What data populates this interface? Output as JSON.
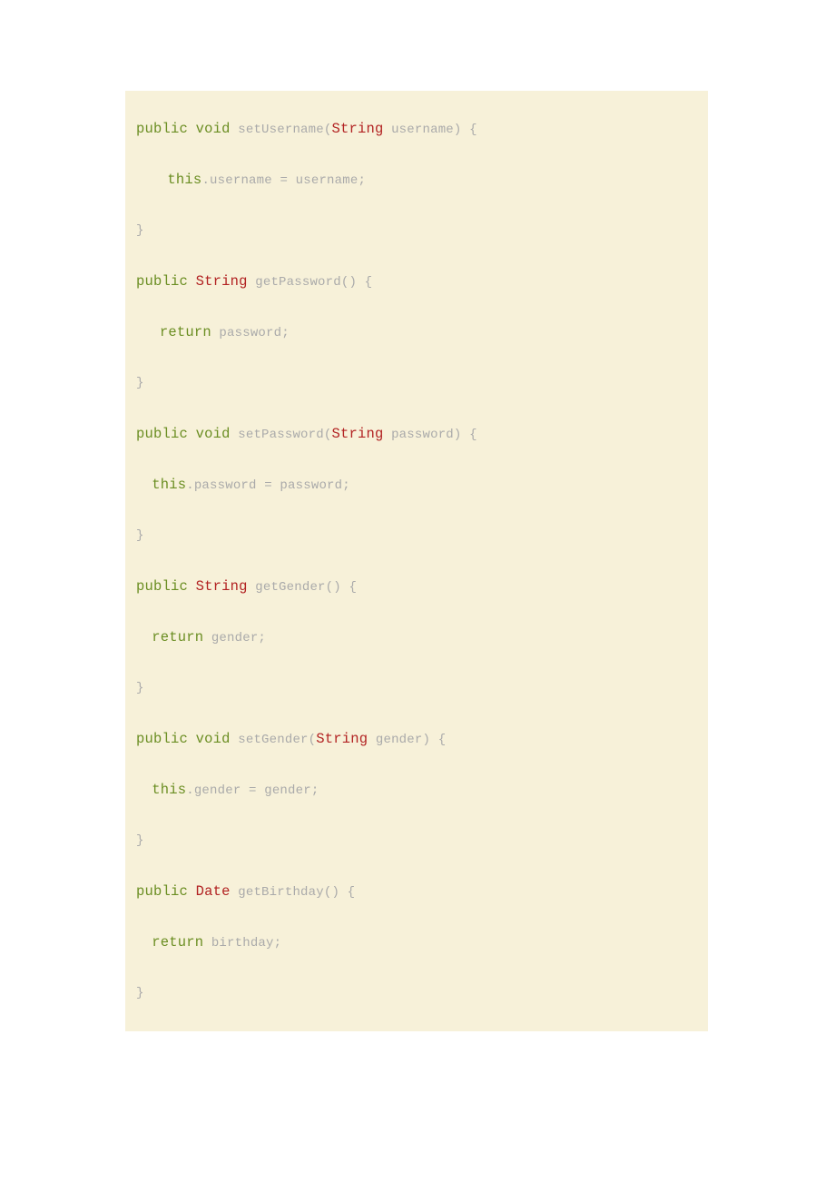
{
  "code": {
    "lines": [
      {
        "indent": 0,
        "segments": [
          {
            "t": "public",
            "c": "kw-public"
          },
          {
            "t": " "
          },
          {
            "t": "void",
            "c": "kw-void"
          },
          {
            "t": " "
          },
          {
            "t": "setUsername("
          },
          {
            "t": "String",
            "c": "kw-type"
          },
          {
            "t": " username) {"
          }
        ]
      },
      {
        "indent": 0,
        "segments": [
          {
            "t": ""
          }
        ]
      },
      {
        "indent": 3,
        "segments": [
          {
            "t": " "
          },
          {
            "t": "this",
            "c": "kw-this"
          },
          {
            "t": ".username = username;"
          }
        ]
      },
      {
        "indent": 0,
        "segments": [
          {
            "t": ""
          }
        ]
      },
      {
        "indent": 0,
        "segments": [
          {
            "t": "}"
          }
        ]
      },
      {
        "indent": 0,
        "segments": [
          {
            "t": ""
          }
        ]
      },
      {
        "indent": 0,
        "segments": [
          {
            "t": "public",
            "c": "kw-public"
          },
          {
            "t": " "
          },
          {
            "t": "String",
            "c": "kw-type"
          },
          {
            "t": " getPassword() {"
          }
        ]
      },
      {
        "indent": 0,
        "segments": [
          {
            "t": ""
          }
        ]
      },
      {
        "indent": 3,
        "segments": [
          {
            "t": "return",
            "c": "kw-return"
          },
          {
            "t": " password;"
          }
        ]
      },
      {
        "indent": 0,
        "segments": [
          {
            "t": ""
          }
        ]
      },
      {
        "indent": 0,
        "segments": [
          {
            "t": "}"
          }
        ]
      },
      {
        "indent": 0,
        "segments": [
          {
            "t": ""
          }
        ]
      },
      {
        "indent": 0,
        "segments": [
          {
            "t": "public",
            "c": "kw-public"
          },
          {
            "t": " "
          },
          {
            "t": "void",
            "c": "kw-void"
          },
          {
            "t": " "
          },
          {
            "t": "setPassword("
          },
          {
            "t": "String",
            "c": "kw-type"
          },
          {
            "t": " password) {"
          }
        ]
      },
      {
        "indent": 0,
        "segments": [
          {
            "t": ""
          }
        ]
      },
      {
        "indent": 2,
        "segments": [
          {
            "t": "this",
            "c": "kw-this"
          },
          {
            "t": ".password = password;"
          }
        ]
      },
      {
        "indent": 0,
        "segments": [
          {
            "t": ""
          }
        ]
      },
      {
        "indent": 0,
        "segments": [
          {
            "t": "}"
          }
        ]
      },
      {
        "indent": 0,
        "segments": [
          {
            "t": ""
          }
        ]
      },
      {
        "indent": 0,
        "segments": [
          {
            "t": "public",
            "c": "kw-public"
          },
          {
            "t": " "
          },
          {
            "t": "String",
            "c": "kw-type"
          },
          {
            "t": " getGender() {"
          }
        ]
      },
      {
        "indent": 0,
        "segments": [
          {
            "t": ""
          }
        ]
      },
      {
        "indent": 2,
        "segments": [
          {
            "t": "return",
            "c": "kw-return"
          },
          {
            "t": " gender;"
          }
        ]
      },
      {
        "indent": 0,
        "segments": [
          {
            "t": ""
          }
        ]
      },
      {
        "indent": 0,
        "segments": [
          {
            "t": "}"
          }
        ]
      },
      {
        "indent": 0,
        "segments": [
          {
            "t": ""
          }
        ]
      },
      {
        "indent": 0,
        "segments": [
          {
            "t": "public",
            "c": "kw-public"
          },
          {
            "t": " "
          },
          {
            "t": "void",
            "c": "kw-void"
          },
          {
            "t": " "
          },
          {
            "t": "setGender("
          },
          {
            "t": "String",
            "c": "kw-type"
          },
          {
            "t": " gender) {"
          }
        ]
      },
      {
        "indent": 0,
        "segments": [
          {
            "t": ""
          }
        ]
      },
      {
        "indent": 2,
        "segments": [
          {
            "t": "this",
            "c": "kw-this"
          },
          {
            "t": ".gender = gender;"
          }
        ]
      },
      {
        "indent": 0,
        "segments": [
          {
            "t": ""
          }
        ]
      },
      {
        "indent": 0,
        "segments": [
          {
            "t": "}"
          }
        ]
      },
      {
        "indent": 0,
        "segments": [
          {
            "t": ""
          }
        ]
      },
      {
        "indent": 0,
        "segments": [
          {
            "t": "public",
            "c": "kw-public"
          },
          {
            "t": " "
          },
          {
            "t": "Date",
            "c": "kw-type"
          },
          {
            "t": " getBirthday() {"
          }
        ]
      },
      {
        "indent": 0,
        "segments": [
          {
            "t": ""
          }
        ]
      },
      {
        "indent": 2,
        "segments": [
          {
            "t": "return",
            "c": "kw-return"
          },
          {
            "t": " birthday;"
          }
        ]
      },
      {
        "indent": 0,
        "segments": [
          {
            "t": ""
          }
        ]
      },
      {
        "indent": 0,
        "segments": [
          {
            "t": "}"
          }
        ]
      }
    ]
  }
}
